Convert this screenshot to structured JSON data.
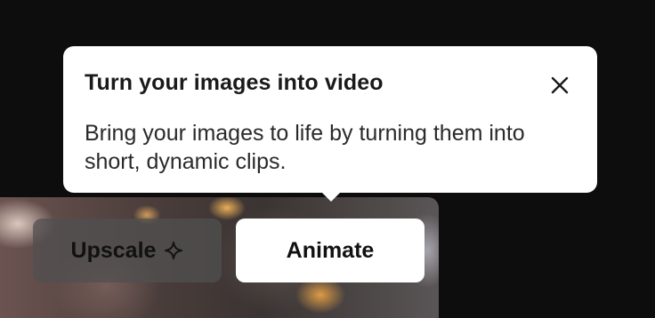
{
  "tooltip": {
    "title": "Turn your images into video",
    "body": "Bring your images to life by turning them into short, dynamic clips.",
    "close_icon": "close-icon"
  },
  "actions": {
    "upscale_label": "Upscale",
    "upscale_icon": "sparkle-icon",
    "animate_label": "Animate"
  }
}
